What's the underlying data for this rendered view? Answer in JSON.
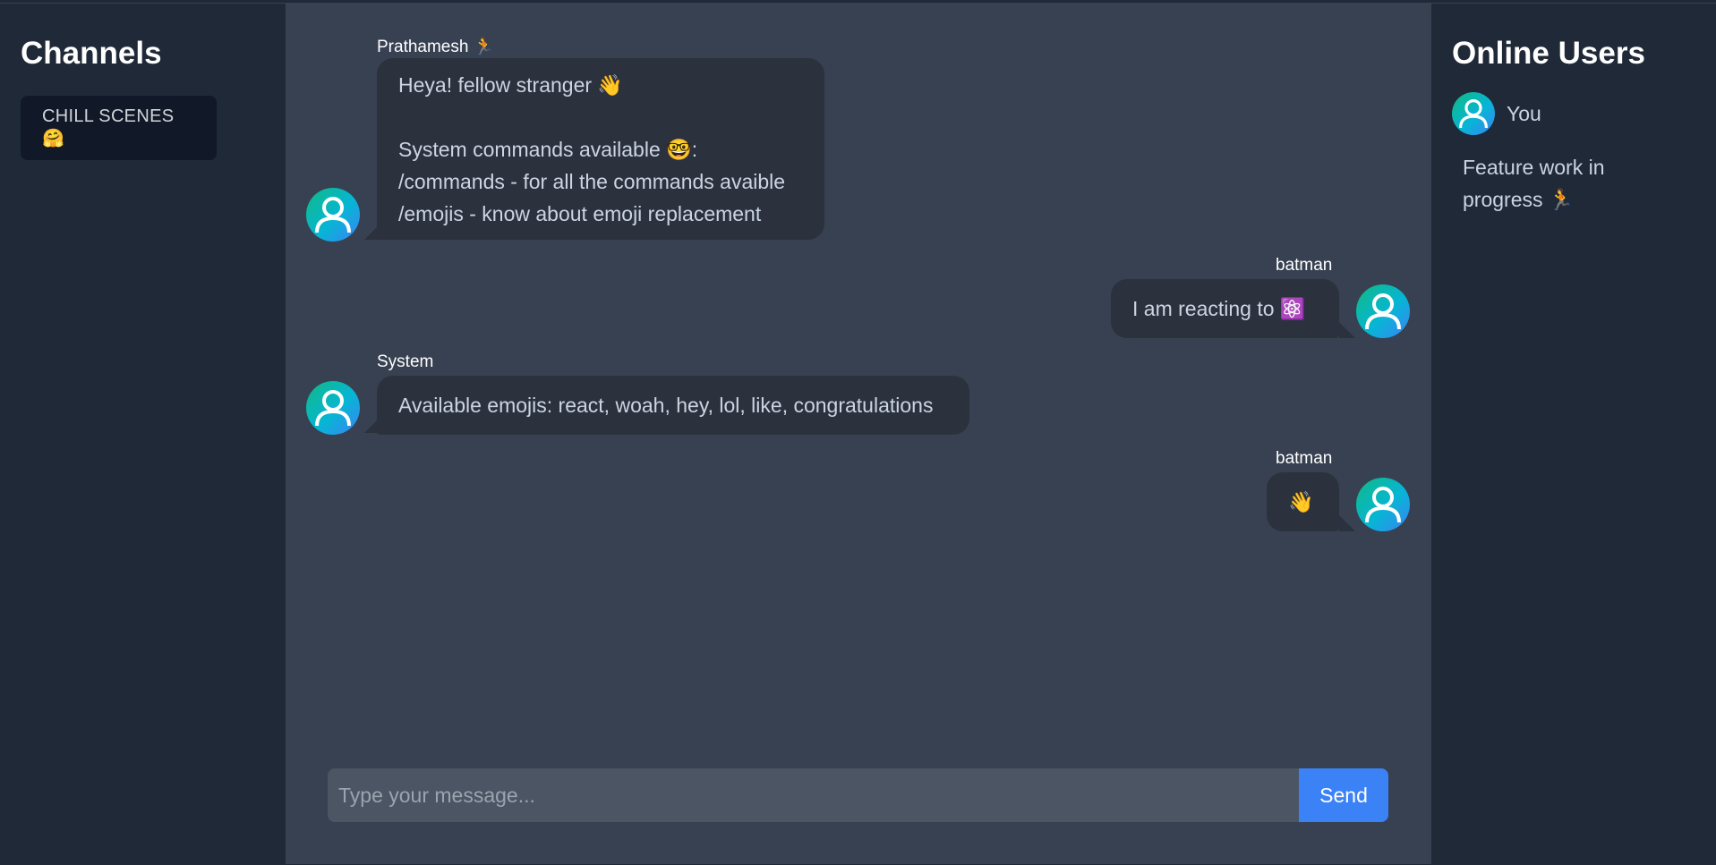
{
  "channels": {
    "title": "Channels",
    "items": [
      {
        "label": "CHILL SCENES 🤗"
      }
    ]
  },
  "chat": {
    "messages": [
      {
        "sender": "Prathamesh 🏃",
        "lines": "Heya! fellow stranger 👋\n\nSystem commands available 🤓:\n/commands - for all the commands avaible\n/emojis - know about emoji replacement",
        "side": "left"
      },
      {
        "sender": "batman",
        "lines": "I am reacting to ⚛️",
        "side": "right"
      },
      {
        "sender": "System",
        "lines": "Available emojis: react, woah, hey, lol, like, congratulations",
        "side": "left"
      },
      {
        "sender": "batman",
        "lines": "👋",
        "side": "right"
      }
    ],
    "composer": {
      "placeholder": "Type your message...",
      "value": "",
      "send_label": "Send"
    }
  },
  "online_users": {
    "title": "Online Users",
    "users": [
      {
        "name": "You"
      }
    ],
    "status_note": "Feature work in progress 🏃"
  },
  "colors": {
    "accent": "#3b82f6",
    "sidebar_bg": "#1f2937",
    "chat_bg": "#374151",
    "bubble_bg": "#2b323e"
  }
}
